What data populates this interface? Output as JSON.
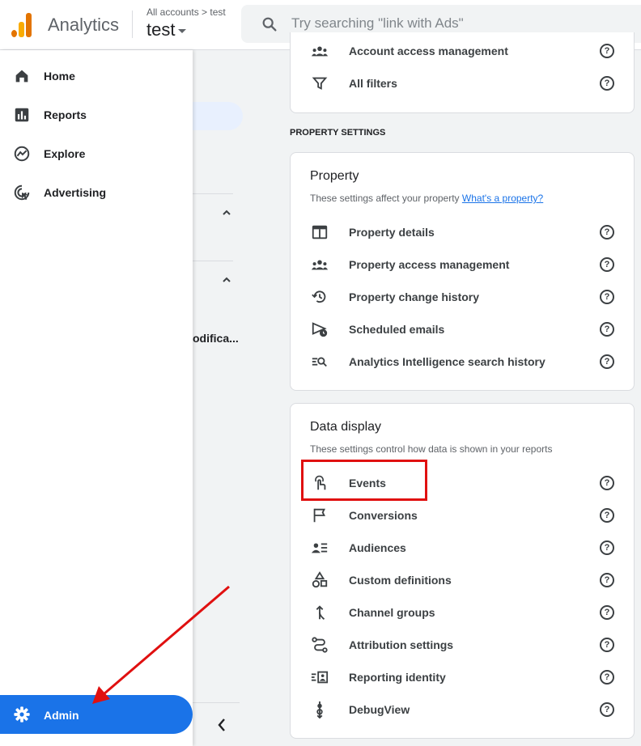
{
  "header": {
    "app_title": "Analytics",
    "breadcrumb": "All accounts > test",
    "property": "test",
    "search_placeholder": "Try searching \"link with Ads\""
  },
  "nav": {
    "items": [
      {
        "label": "Home",
        "icon": "home-icon"
      },
      {
        "label": "Reports",
        "icon": "bar-chart-icon"
      },
      {
        "label": "Explore",
        "icon": "explore-icon"
      },
      {
        "label": "Advertising",
        "icon": "advertising-icon"
      }
    ],
    "admin_label": "Admin",
    "truncated_item": "odifica..."
  },
  "account_card": {
    "rows": [
      {
        "label": "Account access management",
        "icon": "people-icon"
      },
      {
        "label": "All filters",
        "icon": "filter-icon"
      }
    ]
  },
  "property_settings_label": "PROPERTY SETTINGS",
  "property_card": {
    "title": "Property",
    "subtitle": "These settings affect your property",
    "link": "What's a property?",
    "rows": [
      {
        "label": "Property details",
        "icon": "property-details-icon"
      },
      {
        "label": "Property access management",
        "icon": "people-icon"
      },
      {
        "label": "Property change history",
        "icon": "history-icon"
      },
      {
        "label": "Scheduled emails",
        "icon": "scheduled-email-icon"
      },
      {
        "label": "Analytics Intelligence search history",
        "icon": "search-history-icon"
      }
    ]
  },
  "data_display_card": {
    "title": "Data display",
    "subtitle": "These settings control how data is shown in your reports",
    "rows": [
      {
        "label": "Events",
        "icon": "touch-icon"
      },
      {
        "label": "Conversions",
        "icon": "flag-icon"
      },
      {
        "label": "Audiences",
        "icon": "audience-icon"
      },
      {
        "label": "Custom definitions",
        "icon": "shapes-icon"
      },
      {
        "label": "Channel groups",
        "icon": "merge-icon"
      },
      {
        "label": "Attribution settings",
        "icon": "route-icon"
      },
      {
        "label": "Reporting identity",
        "icon": "identity-icon"
      },
      {
        "label": "DebugView",
        "icon": "debug-icon"
      }
    ]
  },
  "colors": {
    "accent": "#1a73e8",
    "annotation": "#e01010",
    "logo_orange": "#f9ab00",
    "logo_dark": "#e37400"
  }
}
